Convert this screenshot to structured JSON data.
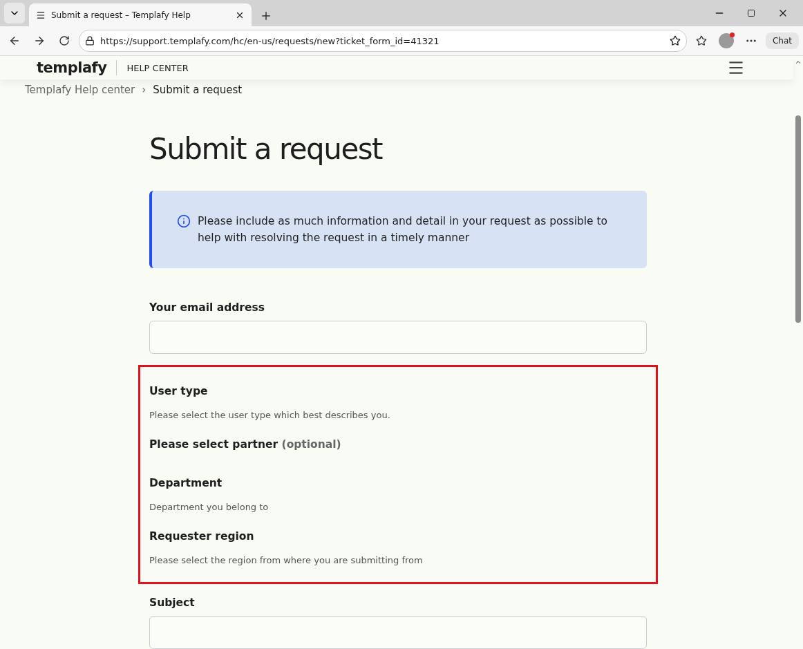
{
  "browser": {
    "tab_title": "Submit a request – Templafy Help",
    "url": "https://support.templafy.com/hc/en-us/requests/new?ticket_form_id=41321",
    "chat_label": "Chat"
  },
  "header": {
    "brand": "templafy",
    "section": "HELP CENTER"
  },
  "breadcrumb": {
    "items": [
      "Templafy Help center",
      "Submit a request"
    ],
    "separator": "›"
  },
  "page_title": "Submit a request",
  "notice": "Please include as much information and detail in your request as possible to help with resolving the request in a timely manner",
  "form_groups": [
    {
      "highlighted": false,
      "fields": [
        {
          "kind": "input",
          "label": "Your email address"
        }
      ]
    },
    {
      "highlighted": true,
      "fields": [
        {
          "kind": "label",
          "label": "User type",
          "hint": "Please select the user type which best describes you."
        },
        {
          "kind": "label",
          "label": "Please select partner",
          "optional": "(optional)"
        },
        {
          "kind": "label",
          "label": "Department",
          "hint": "Department you belong to"
        },
        {
          "kind": "label",
          "label": "Requester region",
          "hint": "Please select the region from where you are submitting from"
        }
      ]
    },
    {
      "highlighted": false,
      "fields": [
        {
          "kind": "input",
          "label": "Subject"
        }
      ]
    }
  ]
}
